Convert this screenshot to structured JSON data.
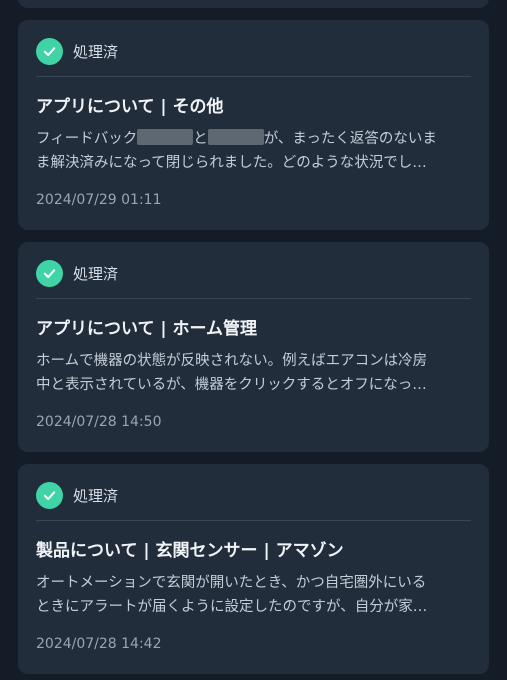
{
  "feedback_list": [
    {
      "status": "処理済",
      "title": "アプリについて | その他",
      "body_line1_a": "フィードバック",
      "body_line1_b": "と",
      "body_line1_c": "が、まったく返答のないま",
      "body_line2": "ま解決済みになって閉じられました。どのような状況でし…",
      "date": "2024/07/29 01:11"
    },
    {
      "status": "処理済",
      "title": "アプリについて | ホーム管理",
      "body_line1": "ホームで機器の状態が反映されない。例えばエアコンは冷房",
      "body_line2": "中と表示されているが、機器をクリックするとオフになっ…",
      "date": "2024/07/28 14:50"
    },
    {
      "status": "処理済",
      "title": "製品について | 玄関センサー | アマゾン",
      "body_line1": "オートメーションで玄関が開いたとき、かつ自宅圏外にいる",
      "body_line2": "ときにアラートが届くように設定したのですが、自分が家…",
      "date": "2024/07/28 14:42"
    }
  ],
  "colors": {
    "background": "#141c28",
    "card": "#222d3c",
    "status_check": "#3fd3a6"
  }
}
